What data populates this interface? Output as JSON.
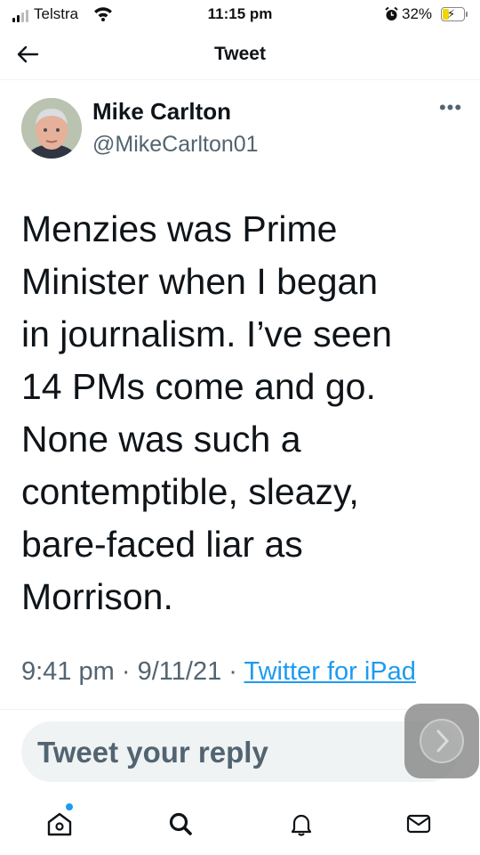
{
  "status_bar": {
    "carrier": "Telstra",
    "time": "11:15 pm",
    "battery_percent": "32%",
    "battery_level": 0.32,
    "signal_bars": 2,
    "icons": [
      "signal-icon",
      "wifi-icon",
      "alarm-icon",
      "battery-charging-icon"
    ]
  },
  "nav": {
    "title": "Tweet",
    "back_icon": "back-arrow-icon"
  },
  "author": {
    "display_name": "Mike Carlton",
    "handle": "@MikeCarlton01",
    "more_icon": "more-icon"
  },
  "tweet": {
    "text": "Menzies was Prime\nMinister when I began\nin journalism. I’ve seen\n14 PMs come and go.\nNone was such a\ncontemptible, sleazy,\nbare-faced liar as\nMorrison.",
    "time": "9:41 pm",
    "separator": "·",
    "date": "9/11/21",
    "source": "Twitter for iPad"
  },
  "reply": {
    "placeholder": "Tweet your reply"
  },
  "tab_bar": {
    "items": [
      "home-icon",
      "search-icon",
      "notifications-icon",
      "messages-icon"
    ]
  },
  "colors": {
    "accent": "#1d9bf0",
    "text": "#0f1419",
    "muted": "#536471",
    "battery": "#f2d600"
  }
}
